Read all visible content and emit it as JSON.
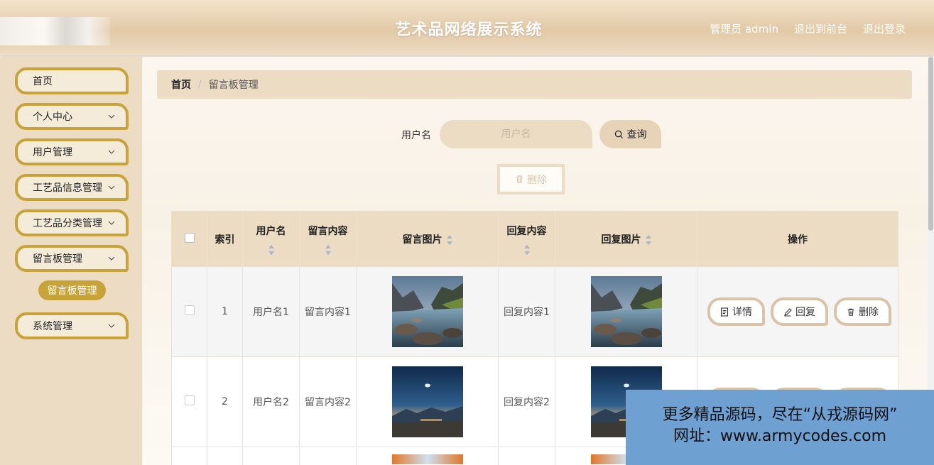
{
  "header": {
    "title": "艺术品网络展示系统",
    "admin_label": "管理员 admin",
    "to_front": "退出到前台",
    "logout": "退出登录"
  },
  "sidebar": {
    "items": [
      {
        "label": "首页",
        "has_children": false
      },
      {
        "label": "个人中心",
        "has_children": true
      },
      {
        "label": "用户管理",
        "has_children": true
      },
      {
        "label": "工艺品信息管理",
        "has_children": true
      },
      {
        "label": "工艺品分类管理",
        "has_children": true
      },
      {
        "label": "留言板管理",
        "has_children": true,
        "expanded": true
      },
      {
        "label": "系统管理",
        "has_children": true
      }
    ],
    "active_sub": "留言板管理"
  },
  "breadcrumb": {
    "home": "首页",
    "separator": "/",
    "current": "留言板管理"
  },
  "search": {
    "label": "用户名",
    "placeholder": "用户名",
    "value": "",
    "query_label": "查询"
  },
  "toolbar": {
    "delete_label": "删除"
  },
  "table": {
    "columns": [
      "索引",
      "用户名",
      "留言内容",
      "留言图片",
      "回复内容",
      "回复图片",
      "操作"
    ],
    "rows": [
      {
        "index": "1",
        "username": "用户名1",
        "message": "留言内容1",
        "reply": "回复内容1",
        "image": "river-valley"
      },
      {
        "index": "2",
        "username": "用户名2",
        "message": "留言内容2",
        "reply": "回复内容2",
        "image": "night-mountain"
      }
    ],
    "actions": {
      "detail": "详情",
      "reply": "回复",
      "delete": "删除"
    }
  },
  "watermark": {
    "line1": "更多精品源码，尽在“从戎源码网”",
    "line2": "网址：www.armycodes.com"
  },
  "colors": {
    "accent_gold": "#c8a33a",
    "panel_beige": "#ecdcc4",
    "watermark_blue": "#6fa0d2"
  }
}
